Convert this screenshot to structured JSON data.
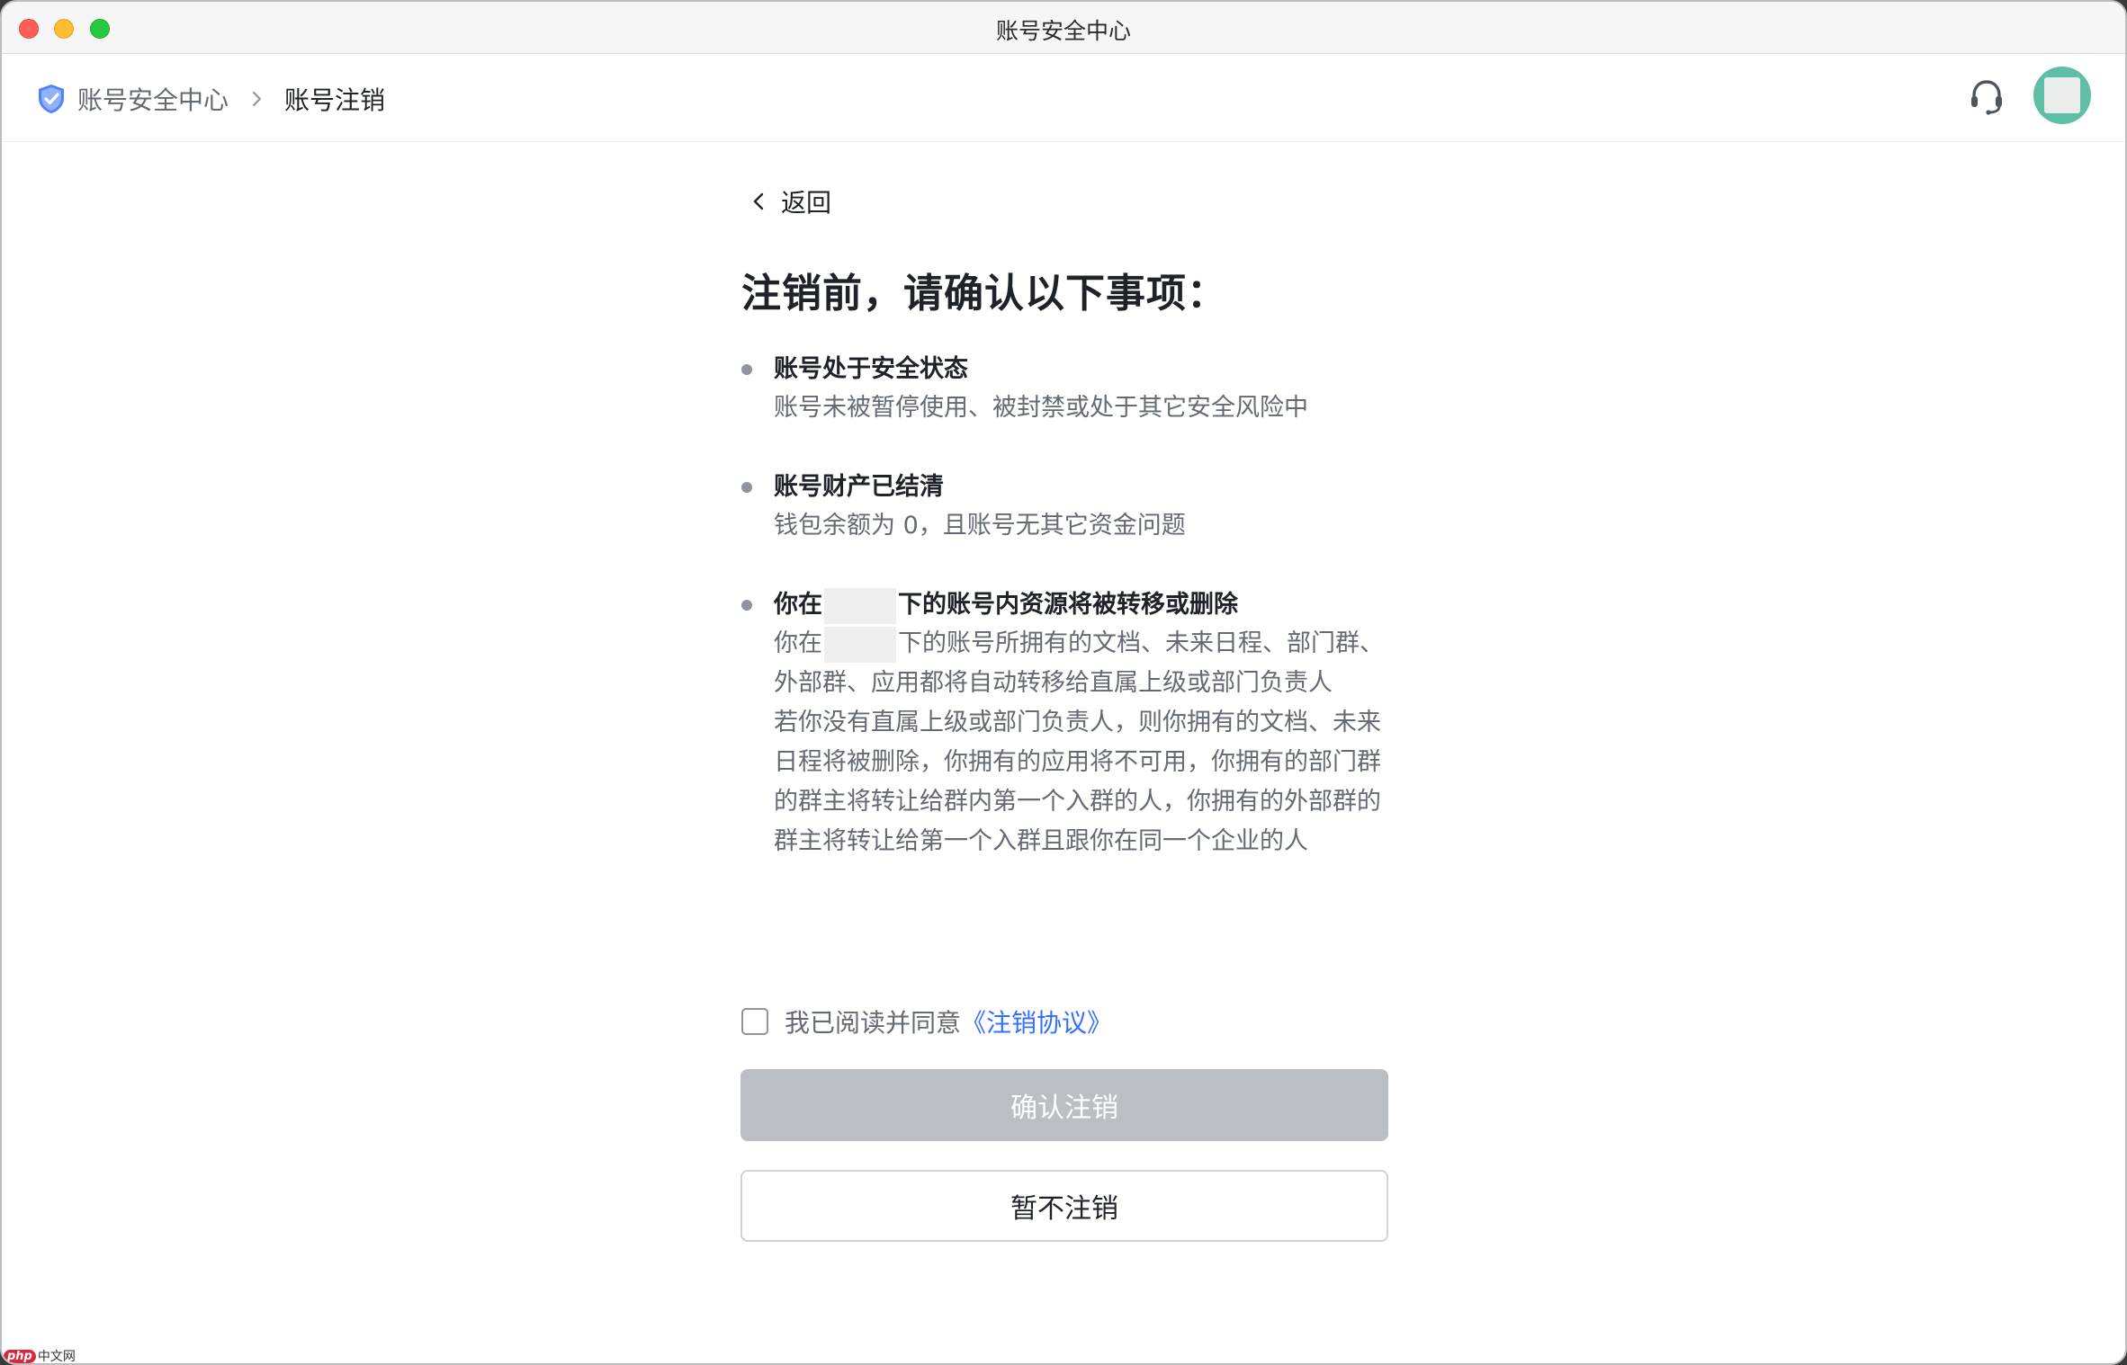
{
  "window": {
    "title": "账号安全中心"
  },
  "breadcrumb": {
    "root": "账号安全中心",
    "current": "账号注销",
    "root_icon": "shield-check-icon",
    "separator_icon": "chevron-right-icon"
  },
  "header_actions": {
    "support_icon": "headset-icon",
    "avatar_icon": "avatar"
  },
  "back": {
    "label": "返回",
    "icon": "chevron-left-icon"
  },
  "main": {
    "heading": "注销前，请确认以下事项：",
    "items": [
      {
        "title": "账号处于安全状态",
        "description": "账号未被暂停使用、被封禁或处于其它安全风险中"
      },
      {
        "title": "账号财产已结清",
        "description": "钱包余额为 0，且账号无其它资金问题"
      },
      {
        "title_prefix": "你在",
        "title_suffix": "下的账号内资源将被转移或删除",
        "description_prefix": "你在",
        "description_suffix": "下的账号所拥有的文档、未来日程、部门群、外部群、应用都将自动转移给直属上级或部门负责人",
        "description_2": "若你没有直属上级或部门负责人，则你拥有的文档、未来日程将被删除，你拥有的应用将不可用，你拥有的部门群的群主将转让给群内第一个入群的人，你拥有的外部群的群主将转让给第一个入群且跟你在同一个企业的人"
      }
    ]
  },
  "agreement": {
    "checked": false,
    "text": "我已阅读并同意",
    "link": "《注销协议》"
  },
  "buttons": {
    "confirm": "确认注销",
    "cancel": "暂不注销"
  },
  "watermark": {
    "logo": "php",
    "text": "中文网"
  },
  "colors": {
    "link": "#3370ff",
    "disabled_button": "#bbbfc4",
    "title_text": "#1f2329",
    "secondary_text": "#646a73"
  }
}
